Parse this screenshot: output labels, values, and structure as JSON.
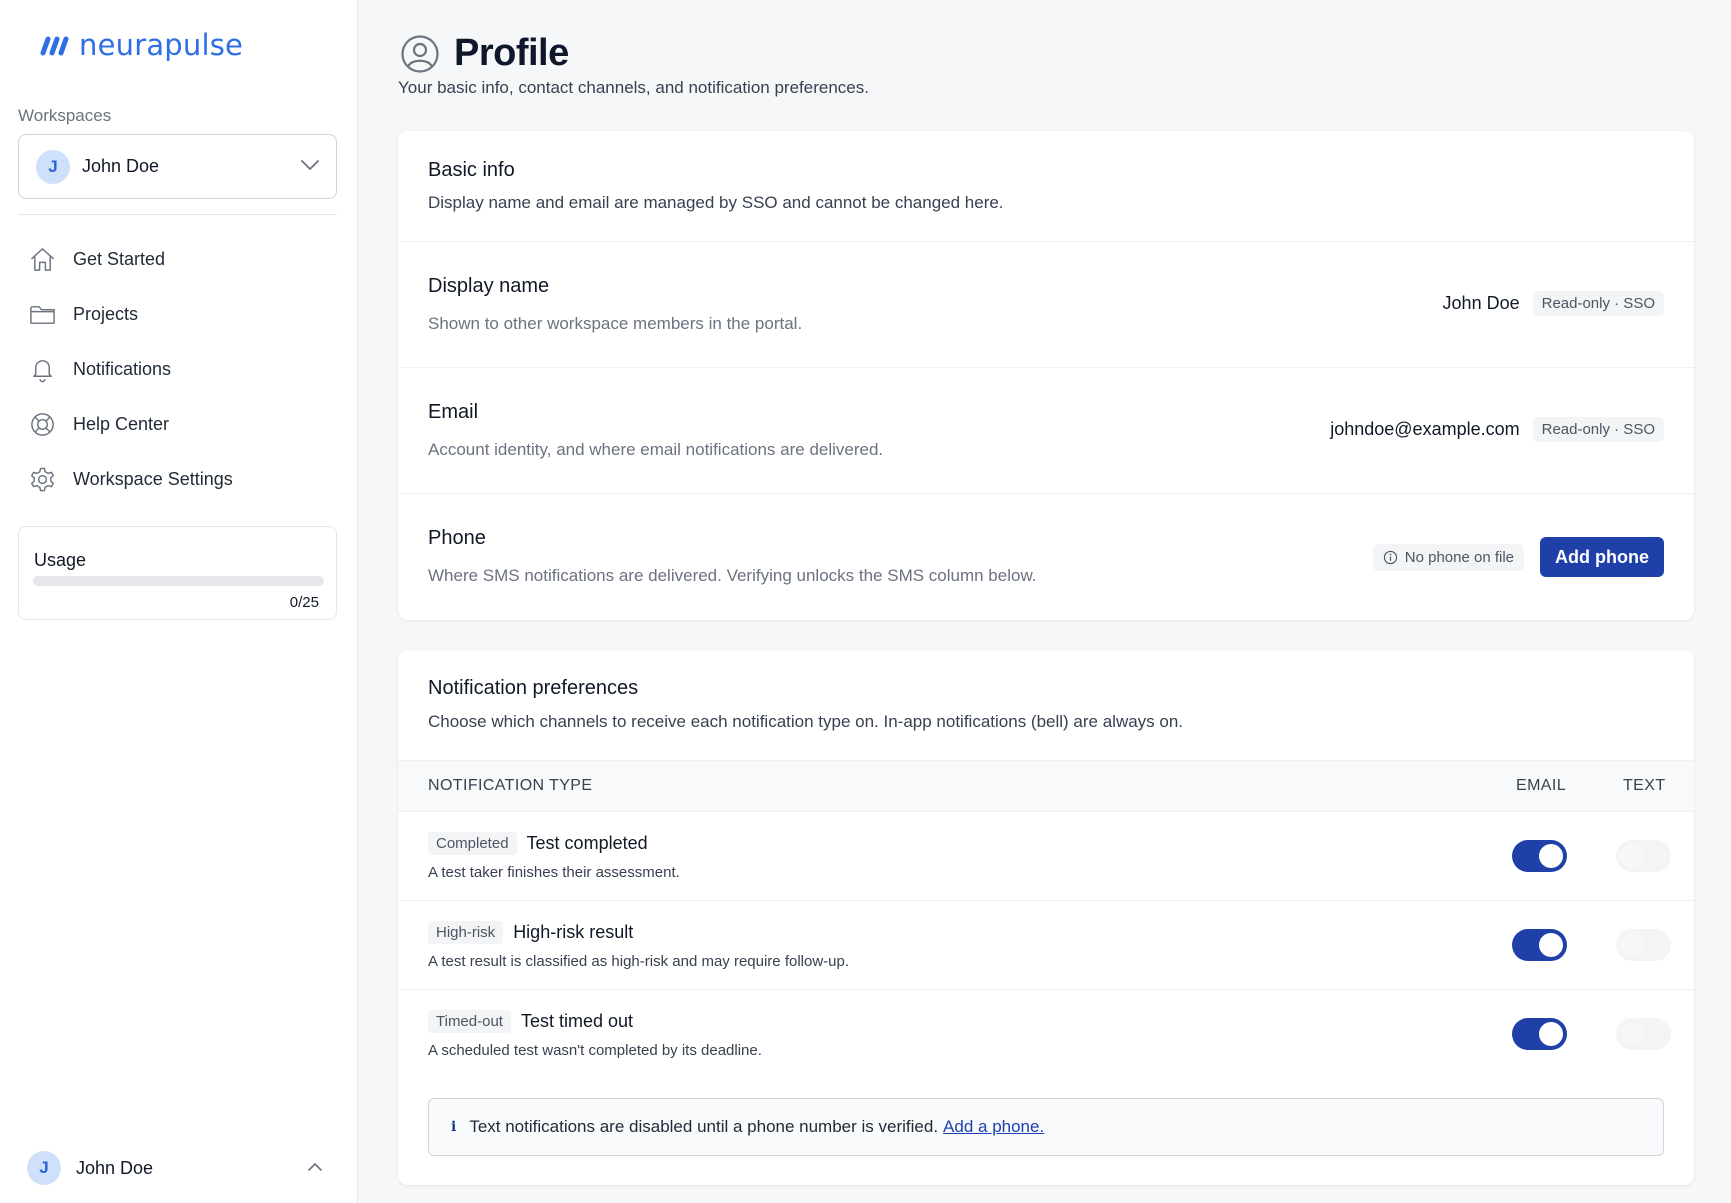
{
  "brand": {
    "name": "neurapulse",
    "color": "#2f6fe4"
  },
  "sidebar": {
    "workspaces_label": "Workspaces",
    "workspace": {
      "initial": "J",
      "name": "John Doe"
    },
    "nav": [
      {
        "label": "Get Started",
        "icon": "home-icon"
      },
      {
        "label": "Projects",
        "icon": "folder-icon"
      },
      {
        "label": "Notifications",
        "icon": "bell-icon"
      },
      {
        "label": "Help Center",
        "icon": "lifebuoy-icon"
      },
      {
        "label": "Workspace Settings",
        "icon": "gear-icon"
      }
    ],
    "usage": {
      "title": "Usage",
      "used": 0,
      "limit": 25,
      "count_text": "0/25"
    },
    "user": {
      "initial": "J",
      "name": "John Doe"
    }
  },
  "page": {
    "title": "Profile",
    "subtitle": "Your basic info, contact channels, and notification preferences."
  },
  "basic_info": {
    "title": "Basic info",
    "description": "Display name and email are managed by SSO and cannot be changed here.",
    "display_name": {
      "label": "Display name",
      "help": "Shown to other workspace members in the portal.",
      "value": "John Doe",
      "badge": "Read-only · SSO"
    },
    "email": {
      "label": "Email",
      "help": "Account identity, and where email notifications are delivered.",
      "value": "johndoe@example.com",
      "badge": "Read-only · SSO"
    },
    "phone": {
      "label": "Phone",
      "help": "Where SMS notifications are delivered. Verifying unlocks the SMS column below.",
      "status": "No phone on file",
      "button": "Add phone"
    }
  },
  "notifications": {
    "title": "Notification preferences",
    "description": "Choose which channels to receive each notification type on. In-app notifications (bell) are always on.",
    "columns": {
      "type": "NOTIFICATION TYPE",
      "email": "EMAIL",
      "text": "TEXT"
    },
    "rows": [
      {
        "tag": "Completed",
        "title": "Test completed",
        "desc": "A test taker finishes their assessment.",
        "email": true,
        "text": false
      },
      {
        "tag": "High-risk",
        "title": "High-risk result",
        "desc": "A test result is classified as high-risk and may require follow-up.",
        "email": true,
        "text": false
      },
      {
        "tag": "Timed-out",
        "title": "Test timed out",
        "desc": "A scheduled test wasn't completed by its deadline.",
        "email": true,
        "text": false
      }
    ],
    "notice": {
      "text": "Text notifications are disabled until a phone number is verified.",
      "link": "Add a phone."
    }
  },
  "colors": {
    "primary": "#1e40a8",
    "toggle_on": "#1e40a8",
    "toggle_off": "#f3f4f6"
  }
}
